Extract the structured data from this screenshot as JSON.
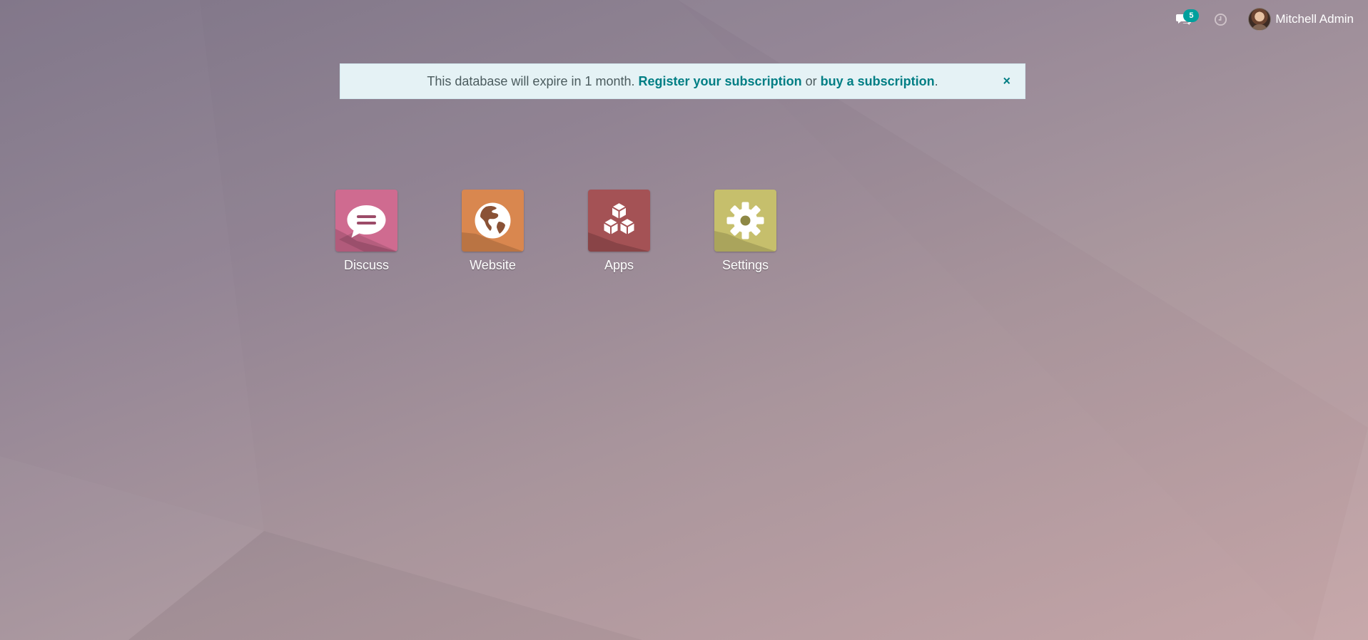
{
  "systray": {
    "messages_icon": "chat-icon",
    "messages_count": "5",
    "activity_icon": "clock-icon",
    "user_name": "Mitchell Admin",
    "badge_color": "#00a09d"
  },
  "alert": {
    "text_before": "This database will expire in 1 month. ",
    "link_register": "Register your subscription",
    "text_middle": " or ",
    "link_buy": "buy a subscription",
    "text_after": ".",
    "close_label": "×",
    "link_color": "#017e84"
  },
  "apps": [
    {
      "label": "Discuss",
      "icon": "chat-bubble-icon",
      "color": "#cf6b90"
    },
    {
      "label": "Website",
      "icon": "globe-icon",
      "color": "#d9874f"
    },
    {
      "label": "Apps",
      "icon": "cubes-icon",
      "color": "#a45255"
    },
    {
      "label": "Settings",
      "icon": "gear-icon",
      "color": "#c6bf6c"
    }
  ]
}
